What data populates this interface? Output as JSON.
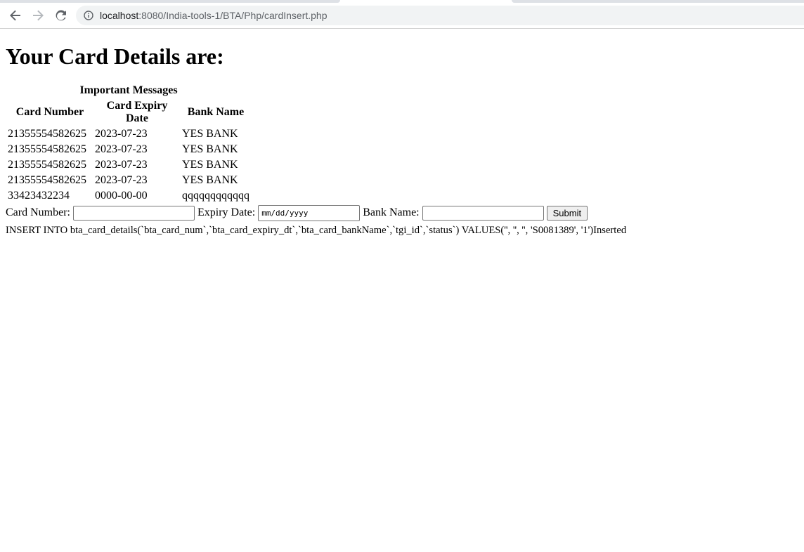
{
  "browser": {
    "url_host": "localhost",
    "url_rest": ":8080/India-tools-1/BTA/Php/cardInsert.php"
  },
  "page": {
    "heading": "Your Card Details are:",
    "table": {
      "caption": "Important Messages",
      "headers": {
        "card_number": "Card Number",
        "card_expiry": "Card Expiry Date",
        "bank_name": "Bank Name"
      },
      "rows": [
        {
          "card_number": "21355554582625",
          "expiry": "2023-07-23",
          "bank": "YES BANK"
        },
        {
          "card_number": "21355554582625",
          "expiry": "2023-07-23",
          "bank": "YES BANK"
        },
        {
          "card_number": "21355554582625",
          "expiry": "2023-07-23",
          "bank": "YES BANK"
        },
        {
          "card_number": "21355554582625",
          "expiry": "2023-07-23",
          "bank": "YES BANK"
        },
        {
          "card_number": "33423432234",
          "expiry": "0000-00-00",
          "bank": "qqqqqqqqqqqq"
        }
      ]
    },
    "form": {
      "card_number_label": "Card Number:",
      "card_number_value": "",
      "expiry_label": "Expiry Date:",
      "expiry_placeholder": "mm/dd/yyyy",
      "bank_label": "Bank Name:",
      "bank_value": "",
      "submit_label": "Submit"
    },
    "sql_output": "INSERT INTO bta_card_details(`bta_card_num`,`bta_card_expiry_dt`,`bta_card_bankName`,`tgi_id`,`status`) VALUES('', '', '', 'S0081389', '1')Inserted"
  }
}
